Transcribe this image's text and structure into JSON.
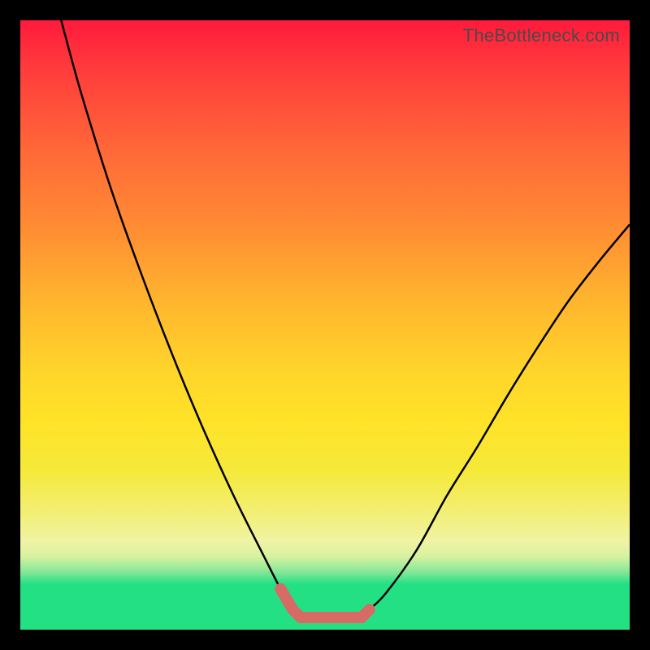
{
  "watermark": "TheBottleneck.com",
  "colors": {
    "gradient_top": "#ff1a3c",
    "gradient_bottom": "#24e085",
    "curve": "#000000",
    "bottom_mark": "#d86a66",
    "frame": "#000000"
  },
  "chart_data": {
    "type": "line",
    "title": "",
    "xlabel": "",
    "ylabel": "",
    "xlim": [
      0,
      100
    ],
    "ylim": [
      0,
      100
    ],
    "series": [
      {
        "name": "left-curve",
        "x": [
          6.7,
          10,
          15,
          20,
          25,
          30,
          35,
          40,
          42.7,
          44.7,
          46
        ],
        "y": [
          100,
          88,
          72,
          58,
          45,
          33,
          22,
          12,
          6.7,
          3.3,
          2
        ]
      },
      {
        "name": "right-curve",
        "x": [
          56,
          57.3,
          60,
          65,
          70,
          75,
          80,
          85,
          90,
          95,
          100
        ],
        "y": [
          2,
          3.3,
          6,
          13,
          22,
          30,
          38.5,
          46.5,
          54,
          60.5,
          66.5
        ]
      },
      {
        "name": "bottom-mark",
        "x": [
          42.7,
          44.7,
          46,
          50,
          54,
          56,
          57.3
        ],
        "y": [
          6.7,
          3.3,
          2,
          2,
          2,
          2,
          3.3
        ]
      }
    ]
  }
}
